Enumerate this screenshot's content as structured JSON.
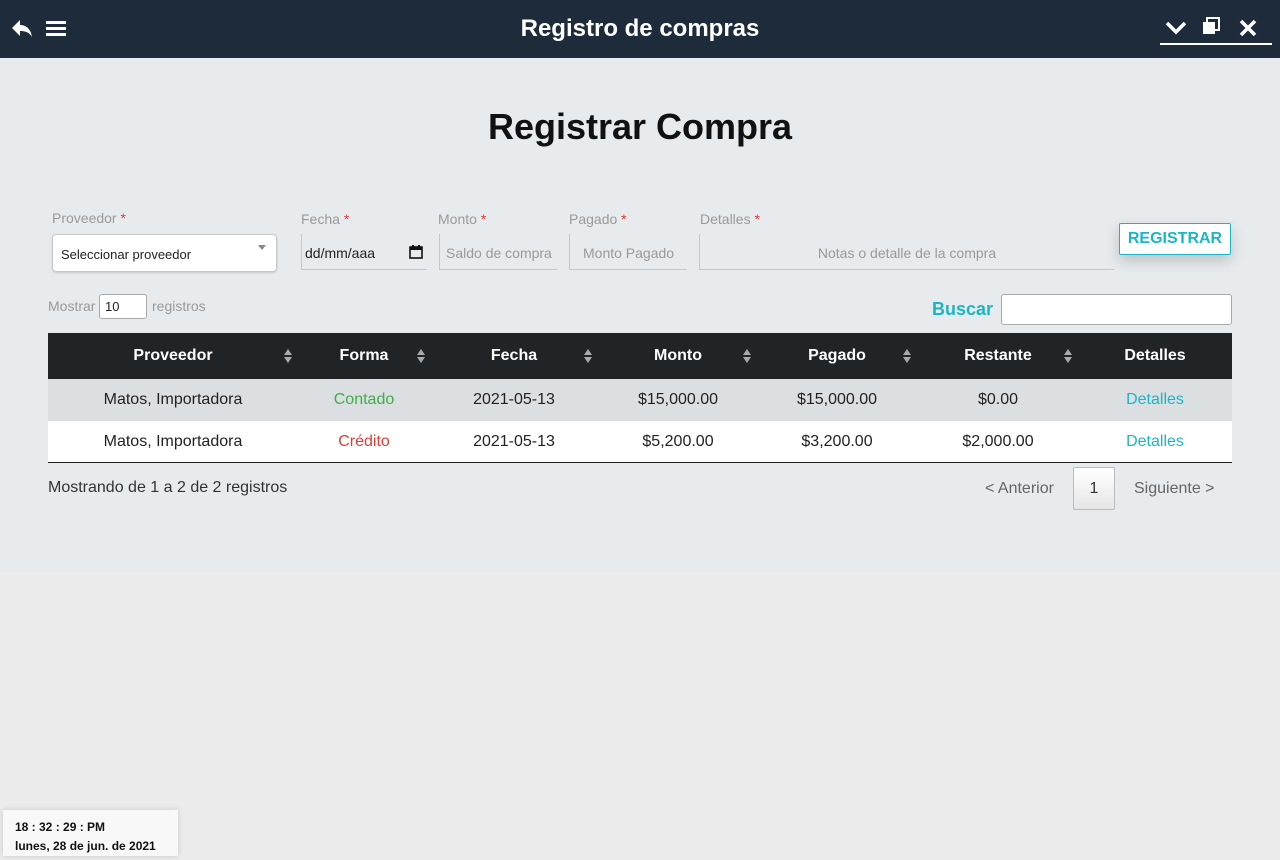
{
  "window": {
    "title": "Registro de compras",
    "icons": {
      "back": "back-arrow-icon",
      "menu": "hamburger-menu-icon",
      "minimize": "chevron-down-icon",
      "restore": "restore-window-icon",
      "close": "close-icon"
    }
  },
  "page": {
    "heading": "Registrar Compra"
  },
  "form": {
    "required_mark": "*",
    "proveedor": {
      "label": "Proveedor",
      "value": "Seleccionar proveedor"
    },
    "fecha": {
      "label": "Fecha",
      "placeholder": "dd/mm/aaa"
    },
    "monto": {
      "label": "Monto",
      "placeholder": "Saldo de compra"
    },
    "pagado": {
      "label": "Pagado",
      "placeholder": "Monto Pagado"
    },
    "detalles": {
      "label": "Detalles",
      "placeholder": "Notas o detalle de la compra"
    },
    "submit_label": "REGISTRAR"
  },
  "table_controls": {
    "show_prefix": "Mostrar",
    "show_value": "10",
    "show_suffix": "registros",
    "search_label": "Buscar",
    "search_value": ""
  },
  "table": {
    "columns": [
      "Proveedor",
      "Forma",
      "Fecha",
      "Monto",
      "Pagado",
      "Restante",
      "Detalles"
    ],
    "rows": [
      {
        "proveedor": "Matos, Importadora",
        "forma": "Contado",
        "fecha": "2021-05-13",
        "monto": "$15,000.00",
        "pagado": "$15,000.00",
        "restante": "$0.00",
        "detalles": "Detalles"
      },
      {
        "proveedor": "Matos, Importadora",
        "forma": "Crédito",
        "fecha": "2021-05-13",
        "monto": "$5,200.00",
        "pagado": "$3,200.00",
        "restante": "$2,000.00",
        "detalles": "Detalles"
      }
    ]
  },
  "pagination": {
    "info": "Mostrando de 1 a 2 de 2 registros",
    "prev": "< Anterior",
    "current": "1",
    "next": "Siguiente >"
  },
  "clock": {
    "time": "18 : 32 : 29 : PM",
    "date": "lunes, 28 de jun. de 2021"
  },
  "colors": {
    "titlebar": "#1d2b3a",
    "accent": "#19b7c6",
    "contado": "#3fae49",
    "credito": "#e53935",
    "table_header": "#212427"
  }
}
